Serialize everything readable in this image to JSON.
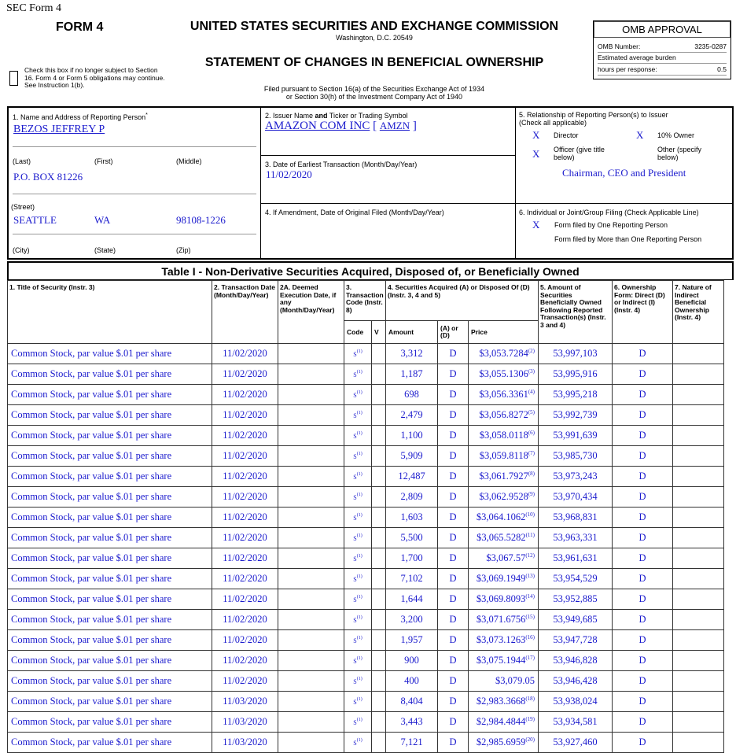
{
  "header": {
    "sec_form": "SEC Form 4",
    "form": "FORM 4",
    "agency": "UNITED STATES SECURITIES AND EXCHANGE COMMISSION",
    "city": "Washington, D.C. 20549",
    "statement": "STATEMENT OF CHANGES IN BENEFICIAL OWNERSHIP",
    "filed_line1": "Filed pursuant to Section 16(a) of the Securities Exchange Act of 1934",
    "filed_line2": "or Section 30(h) of the Investment Company Act of 1940",
    "check_text": "Check this box if no longer subject to Section 16. Form 4 or Form 5 obligations may continue. See Instruction 1(b)."
  },
  "omb": {
    "title": "OMB APPROVAL",
    "number_label": "OMB Number:",
    "number": "3235-0287",
    "burden_label": "Estimated average burden",
    "hours_label": "hours per response:",
    "hours": "0.5"
  },
  "box1": {
    "label": "1. Name and Address of Reporting Person",
    "label_mark": "*",
    "name": "BEZOS JEFFREY P",
    "last": "(Last)",
    "first": "(First)",
    "middle": "(Middle)",
    "address": "P.O. BOX 81226",
    "street": "(Street)",
    "city_value": "SEATTLE",
    "state_value": "WA",
    "zip_value": "98108-1226",
    "city": "(City)",
    "state": "(State)",
    "zip": "(Zip)"
  },
  "box2": {
    "label_pre": "2. Issuer Name ",
    "label_and": "and",
    "label_post": " Ticker or Trading Symbol",
    "issuer": "AMAZON COM INC",
    "ticker_open": "[ ",
    "ticker": "AMZN",
    "ticker_close": " ]"
  },
  "box3": {
    "label": "3. Date of Earliest Transaction (Month/Day/Year)",
    "date": "11/02/2020"
  },
  "box4": {
    "label": "4. If Amendment, Date of Original Filed (Month/Day/Year)"
  },
  "box5": {
    "label1": "5. Relationship of Reporting Person(s) to Issuer",
    "label2": "(Check all applicable)",
    "director_mark": "X",
    "director": "Director",
    "owner_mark": "X",
    "owner": "10% Owner",
    "officer_mark": "X",
    "officer": "Officer (give title below)",
    "other": "Other (specify below)",
    "title": "Chairman, CEO and President"
  },
  "box6": {
    "label": "6. Individual or Joint/Group Filing (Check Applicable Line)",
    "one_mark": "X",
    "one": "Form filed by One Reporting Person",
    "more": "Form filed by More than One Reporting Person"
  },
  "table": {
    "title": "Table I - Non-Derivative Securities Acquired, Disposed of, or Beneficially Owned",
    "h1": "1. Title of Security (Instr. 3)",
    "h2": "2. Transaction Date (Month/Day/Year)",
    "h2a": "2A. Deemed Execution Date, if any (Month/Day/Year)",
    "h3": "3. Transaction Code (Instr. 8)",
    "h4": "4. Securities Acquired (A) or Disposed Of (D) (Instr. 3, 4 and 5)",
    "h5": "5. Amount of Securities Beneficially Owned Following Reported Transaction(s) (Instr. 3 and 4)",
    "h6": "6. Ownership Form: Direct (D) or Indirect (I) (Instr. 4)",
    "h7": "7. Nature of Indirect Beneficial Ownership (Instr. 4)",
    "sub_code": "Code",
    "sub_v": "V",
    "sub_amount": "Amount",
    "sub_ad": "(A) or (D)",
    "sub_price": "Price",
    "rows": [
      {
        "title": "Common Stock, par value $.01 per share",
        "date": "11/02/2020",
        "code": "S",
        "code_fn": "(1)",
        "amount": "3,312",
        "ad": "D",
        "price": "$3,053.7284",
        "price_fn": "(2)",
        "owned": "53,997,103",
        "form": "D"
      },
      {
        "title": "Common Stock, par value $.01 per share",
        "date": "11/02/2020",
        "code": "S",
        "code_fn": "(1)",
        "amount": "1,187",
        "ad": "D",
        "price": "$3,055.1306",
        "price_fn": "(3)",
        "owned": "53,995,916",
        "form": "D"
      },
      {
        "title": "Common Stock, par value $.01 per share",
        "date": "11/02/2020",
        "code": "S",
        "code_fn": "(1)",
        "amount": "698",
        "ad": "D",
        "price": "$3,056.3361",
        "price_fn": "(4)",
        "owned": "53,995,218",
        "form": "D"
      },
      {
        "title": "Common Stock, par value $.01 per share",
        "date": "11/02/2020",
        "code": "S",
        "code_fn": "(1)",
        "amount": "2,479",
        "ad": "D",
        "price": "$3,056.8272",
        "price_fn": "(5)",
        "owned": "53,992,739",
        "form": "D"
      },
      {
        "title": "Common Stock, par value $.01 per share",
        "date": "11/02/2020",
        "code": "S",
        "code_fn": "(1)",
        "amount": "1,100",
        "ad": "D",
        "price": "$3,058.0118",
        "price_fn": "(6)",
        "owned": "53,991,639",
        "form": "D"
      },
      {
        "title": "Common Stock, par value $.01 per share",
        "date": "11/02/2020",
        "code": "S",
        "code_fn": "(1)",
        "amount": "5,909",
        "ad": "D",
        "price": "$3,059.8118",
        "price_fn": "(7)",
        "owned": "53,985,730",
        "form": "D"
      },
      {
        "title": "Common Stock, par value $.01 per share",
        "date": "11/02/2020",
        "code": "S",
        "code_fn": "(1)",
        "amount": "12,487",
        "ad": "D",
        "price": "$3,061.7927",
        "price_fn": "(8)",
        "owned": "53,973,243",
        "form": "D"
      },
      {
        "title": "Common Stock, par value $.01 per share",
        "date": "11/02/2020",
        "code": "S",
        "code_fn": "(1)",
        "amount": "2,809",
        "ad": "D",
        "price": "$3,062.9528",
        "price_fn": "(9)",
        "owned": "53,970,434",
        "form": "D"
      },
      {
        "title": "Common Stock, par value $.01 per share",
        "date": "11/02/2020",
        "code": "S",
        "code_fn": "(1)",
        "amount": "1,603",
        "ad": "D",
        "price": "$3,064.1062",
        "price_fn": "(10)",
        "owned": "53,968,831",
        "form": "D"
      },
      {
        "title": "Common Stock, par value $.01 per share",
        "date": "11/02/2020",
        "code": "S",
        "code_fn": "(1)",
        "amount": "5,500",
        "ad": "D",
        "price": "$3,065.5282",
        "price_fn": "(11)",
        "owned": "53,963,331",
        "form": "D"
      },
      {
        "title": "Common Stock, par value $.01 per share",
        "date": "11/02/2020",
        "code": "S",
        "code_fn": "(1)",
        "amount": "1,700",
        "ad": "D",
        "price": "$3,067.57",
        "price_fn": "(12)",
        "owned": "53,961,631",
        "form": "D"
      },
      {
        "title": "Common Stock, par value $.01 per share",
        "date": "11/02/2020",
        "code": "S",
        "code_fn": "(1)",
        "amount": "7,102",
        "ad": "D",
        "price": "$3,069.1949",
        "price_fn": "(13)",
        "owned": "53,954,529",
        "form": "D"
      },
      {
        "title": "Common Stock, par value $.01 per share",
        "date": "11/02/2020",
        "code": "S",
        "code_fn": "(1)",
        "amount": "1,644",
        "ad": "D",
        "price": "$3,069.8093",
        "price_fn": "(14)",
        "owned": "53,952,885",
        "form": "D"
      },
      {
        "title": "Common Stock, par value $.01 per share",
        "date": "11/02/2020",
        "code": "S",
        "code_fn": "(1)",
        "amount": "3,200",
        "ad": "D",
        "price": "$3,071.6756",
        "price_fn": "(15)",
        "owned": "53,949,685",
        "form": "D"
      },
      {
        "title": "Common Stock, par value $.01 per share",
        "date": "11/02/2020",
        "code": "S",
        "code_fn": "(1)",
        "amount": "1,957",
        "ad": "D",
        "price": "$3,073.1263",
        "price_fn": "(16)",
        "owned": "53,947,728",
        "form": "D"
      },
      {
        "title": "Common Stock, par value $.01 per share",
        "date": "11/02/2020",
        "code": "S",
        "code_fn": "(1)",
        "amount": "900",
        "ad": "D",
        "price": "$3,075.1944",
        "price_fn": "(17)",
        "owned": "53,946,828",
        "form": "D"
      },
      {
        "title": "Common Stock, par value $.01 per share",
        "date": "11/02/2020",
        "code": "S",
        "code_fn": "(1)",
        "amount": "400",
        "ad": "D",
        "price": "$3,079.05",
        "price_fn": "",
        "owned": "53,946,428",
        "form": "D"
      },
      {
        "title": "Common Stock, par value $.01 per share",
        "date": "11/03/2020",
        "code": "S",
        "code_fn": "(1)",
        "amount": "8,404",
        "ad": "D",
        "price": "$2,983.3668",
        "price_fn": "(18)",
        "owned": "53,938,024",
        "form": "D"
      },
      {
        "title": "Common Stock, par value $.01 per share",
        "date": "11/03/2020",
        "code": "S",
        "code_fn": "(1)",
        "amount": "3,443",
        "ad": "D",
        "price": "$2,984.4844",
        "price_fn": "(19)",
        "owned": "53,934,581",
        "form": "D"
      },
      {
        "title": "Common Stock, par value $.01 per share",
        "date": "11/03/2020",
        "code": "S",
        "code_fn": "(1)",
        "amount": "7,121",
        "ad": "D",
        "price": "$2,985.6959",
        "price_fn": "(20)",
        "owned": "53,927,460",
        "form": "D"
      }
    ]
  }
}
